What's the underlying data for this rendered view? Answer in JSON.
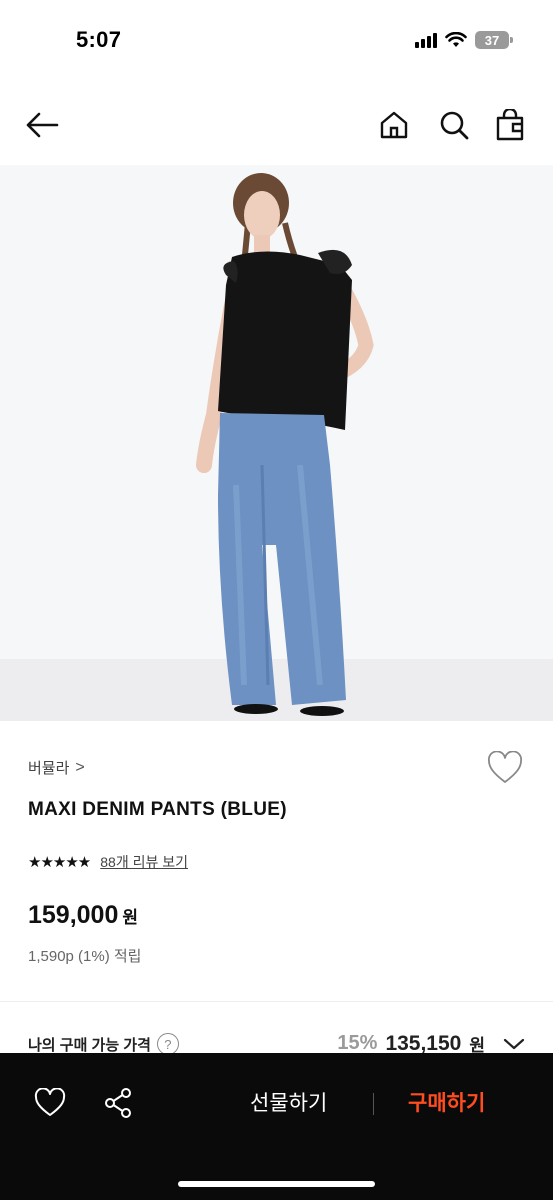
{
  "status": {
    "time": "5:07",
    "battery": "37"
  },
  "header": {
    "icons": [
      "back-arrow-icon",
      "home-icon",
      "search-icon",
      "shopping-bag-icon"
    ]
  },
  "product": {
    "brand": "버뮬라",
    "brand_chevron": ">",
    "name": "MAXI DENIM PANTS (BLUE)",
    "stars": "★★★★★",
    "reviews_link": "88개 리뷰 보기",
    "price": "159,000",
    "currency": "원",
    "points": "1,590p (1%) 적립"
  },
  "my_best_price": {
    "label": "나의 구매 가능 가격",
    "help": "?",
    "discount": "15%",
    "price": "135,150",
    "currency": "원"
  },
  "bottom_bar": {
    "gift_label": "선물하기",
    "buy_label": "구매하기",
    "icons": [
      "heart-icon",
      "share-icon"
    ]
  },
  "colors": {
    "accent_buy": "#ff4d1f",
    "bottom_bar_bg": "#0a0a0a"
  }
}
